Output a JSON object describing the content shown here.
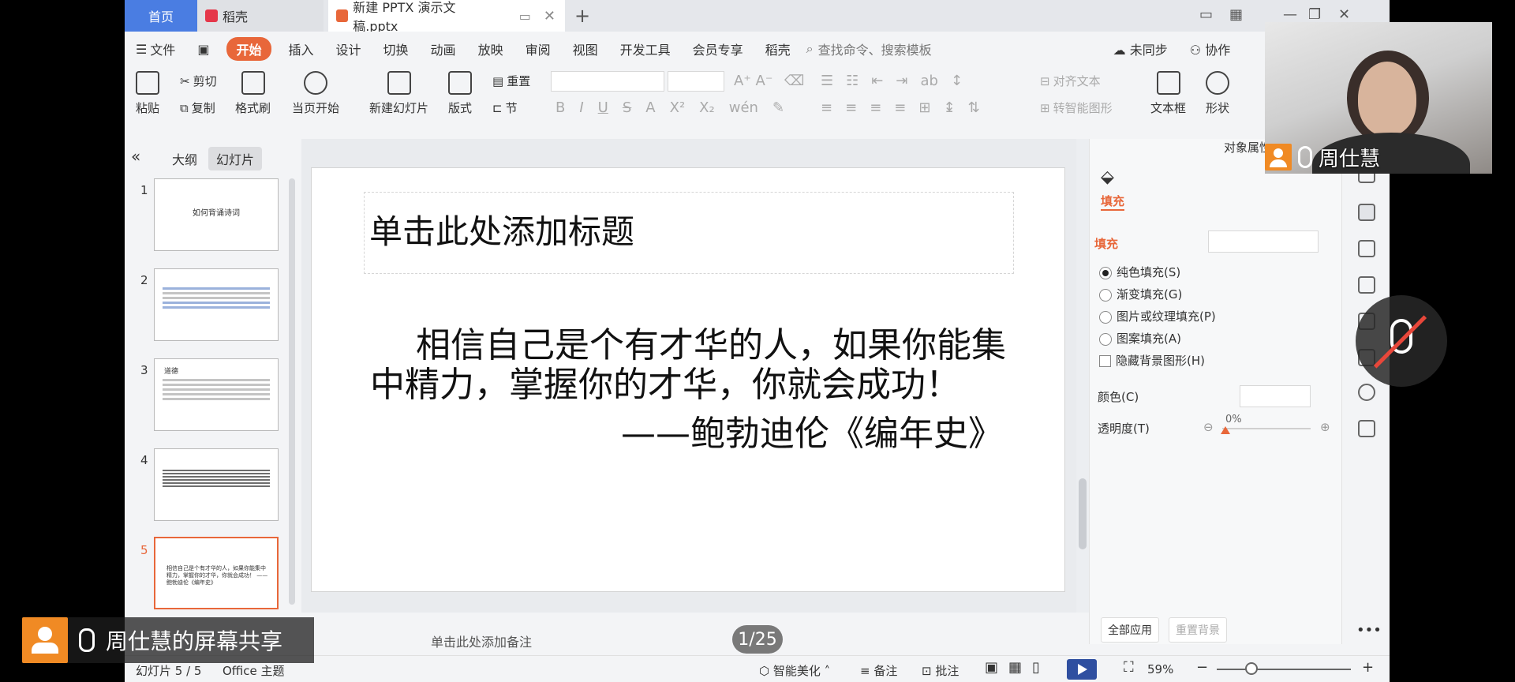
{
  "titlebar": {
    "tab_home": "首页",
    "tab_docer": "稻壳",
    "tab_file": "新建 PPTX 演示文稿.pptx"
  },
  "menubar": {
    "file": "文件",
    "start": "开始",
    "items": [
      "插入",
      "设计",
      "切换",
      "动画",
      "放映",
      "审阅",
      "视图",
      "开发工具",
      "会员专享",
      "稻壳"
    ],
    "search_placeholder": "查找命令、搜索模板",
    "sync": "未同步",
    "collab": "协作"
  },
  "ribbon": {
    "paste": "粘贴",
    "cut": "剪切",
    "copy": "复制",
    "format_painter": "格式刷",
    "from_current": "当页开始",
    "new_slide": "新建幻灯片",
    "layout": "版式",
    "reset": "重置",
    "section": "节",
    "align_text": "对齐文本",
    "smart_art": "转智能图形",
    "textbox": "文本框",
    "shape": "形状"
  },
  "leftpanel": {
    "outline_tab": "大纲",
    "slides_tab": "幻灯片",
    "thumbs": [
      {
        "num": "1",
        "title": "如何背诵诗词"
      },
      {
        "num": "2",
        "title": ""
      },
      {
        "num": "3",
        "title": "道德"
      },
      {
        "num": "4",
        "title": ""
      },
      {
        "num": "5",
        "title": "相信自己是个有才华的人，如果你能集中精力，掌握你的才华，你就会成功！ ——鲍勃迪伦《编年史》"
      }
    ]
  },
  "slide": {
    "title_placeholder": "单击此处添加标题",
    "body_line1": "相信自己是个有才华的人，如果你能集",
    "body_line2": "中精力，掌握你的才华，你就会成功！",
    "attribution": "——鲍勃迪伦《编年史》"
  },
  "properties": {
    "header": "对象属性",
    "tab_fill": "填充",
    "section_fill": "填充",
    "options": [
      "纯色填充(S)",
      "渐变填充(G)",
      "图片或纹理填充(P)",
      "图案填充(A)"
    ],
    "selected_option": 0,
    "hide_bg_graphics": "隐藏背景图形(H)",
    "color_label": "颜色(C)",
    "transparency_label": "透明度(T)",
    "transparency_value": "0%",
    "apply_all": "全部应用",
    "reset_bg": "重置背景"
  },
  "notes": {
    "placeholder": "单击此处添加备注"
  },
  "statusbar": {
    "slide_pos": "幻灯片 5 / 5",
    "theme": "Office 主题",
    "beautify": "智能美化",
    "notes_btn": "备注",
    "comments_btn": "批注",
    "zoom": "59%"
  },
  "overlay": {
    "presenter_name": "周仕慧",
    "share_text": "周仕慧的屏幕共享",
    "page_counter": "1/25"
  },
  "colors": {
    "accent": "#e8673a",
    "home_tab": "#4a7de2",
    "play": "#2f4fa0"
  }
}
